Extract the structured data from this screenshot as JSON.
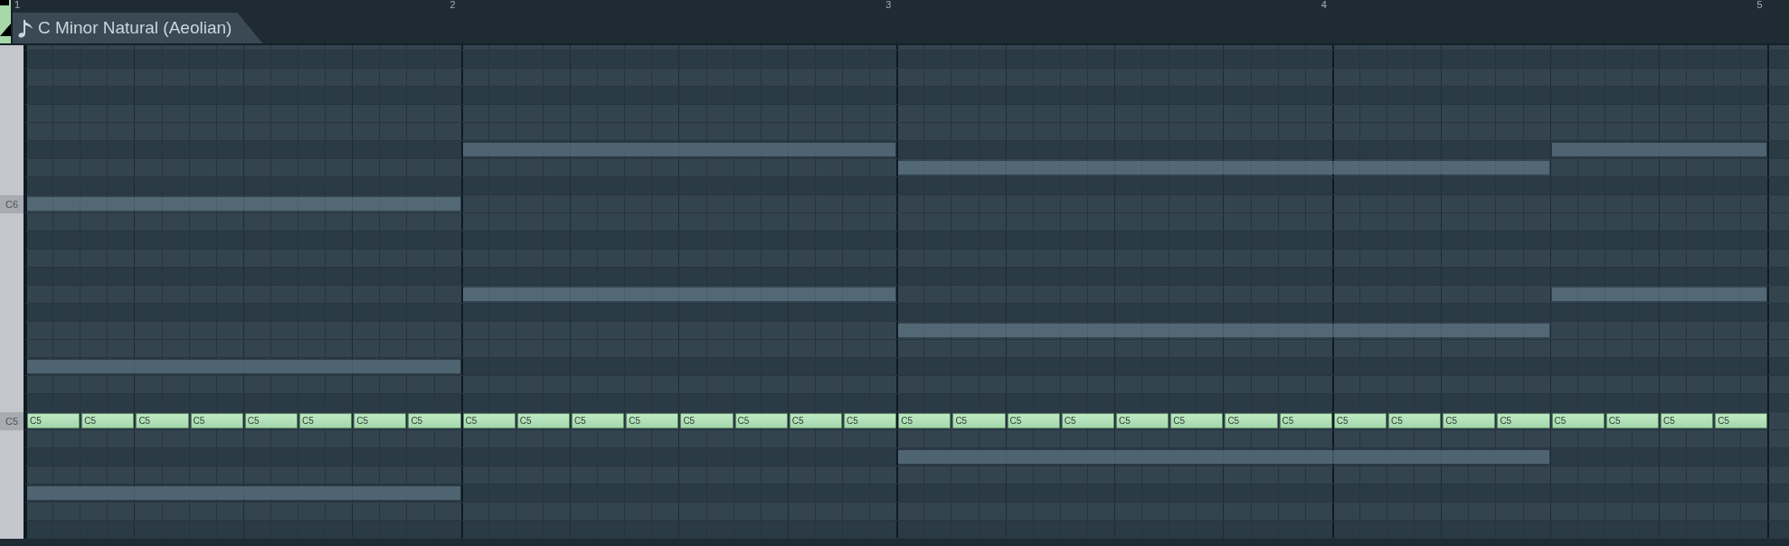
{
  "ruler": {
    "bars": [
      "1",
      "2",
      "3",
      "4",
      "5"
    ]
  },
  "scale_tab": {
    "label": "C Minor Natural (Aeolian)"
  },
  "rows": [
    {
      "kind": "white"
    },
    {
      "kind": "black"
    },
    {
      "kind": "white"
    },
    {
      "kind": "black"
    },
    {
      "kind": "white"
    },
    {
      "kind": "white"
    },
    {
      "kind": "black",
      "ghost": [
        false,
        false,
        true,
        true,
        false,
        false,
        false,
        true
      ]
    },
    {
      "kind": "white",
      "ghost": [
        false,
        false,
        false,
        false,
        true,
        true,
        true,
        false
      ]
    },
    {
      "kind": "black"
    },
    {
      "kind": "white",
      "label": "C6",
      "ghost": [
        true,
        true,
        false,
        false,
        false,
        false,
        false,
        false
      ]
    },
    {
      "kind": "white"
    },
    {
      "kind": "black"
    },
    {
      "kind": "white"
    },
    {
      "kind": "black"
    },
    {
      "kind": "white",
      "ghost": [
        false,
        false,
        true,
        true,
        false,
        false,
        false,
        true
      ]
    },
    {
      "kind": "black"
    },
    {
      "kind": "white",
      "ghost": [
        false,
        false,
        false,
        false,
        true,
        true,
        true,
        false
      ]
    },
    {
      "kind": "white"
    },
    {
      "kind": "black",
      "ghost": [
        true,
        true,
        false,
        false,
        false,
        false,
        false,
        false
      ]
    },
    {
      "kind": "white"
    },
    {
      "kind": "black"
    },
    {
      "kind": "white",
      "label": "C5",
      "notes": [
        {
          "label": "C5"
        },
        {
          "label": "C5"
        },
        {
          "label": "C5"
        },
        {
          "label": "C5"
        },
        {
          "label": "C5"
        },
        {
          "label": "C5"
        },
        {
          "label": "C5"
        },
        {
          "label": "C5"
        },
        {
          "label": "C5"
        },
        {
          "label": "C5"
        },
        {
          "label": "C5"
        },
        {
          "label": "C5"
        },
        {
          "label": "C5"
        },
        {
          "label": "C5"
        },
        {
          "label": "C5"
        },
        {
          "label": "C5"
        },
        {
          "label": "C5"
        },
        {
          "label": "C5"
        },
        {
          "label": "C5"
        },
        {
          "label": "C5"
        },
        {
          "label": "C5"
        },
        {
          "label": "C5"
        },
        {
          "label": "C5"
        },
        {
          "label": "C5"
        },
        {
          "label": "C5"
        },
        {
          "label": "C5"
        },
        {
          "label": "C5"
        },
        {
          "label": "C5"
        },
        {
          "label": "C5"
        },
        {
          "label": "C5"
        },
        {
          "label": "C5"
        },
        {
          "label": "C5"
        }
      ]
    },
    {
      "kind": "white"
    },
    {
      "kind": "black",
      "ghost": [
        false,
        false,
        false,
        false,
        true,
        true,
        true,
        false
      ]
    },
    {
      "kind": "white"
    },
    {
      "kind": "black",
      "ghost": [
        true,
        true,
        false,
        false,
        false,
        false,
        false,
        false
      ]
    },
    {
      "kind": "white"
    },
    {
      "kind": "black"
    }
  ]
}
